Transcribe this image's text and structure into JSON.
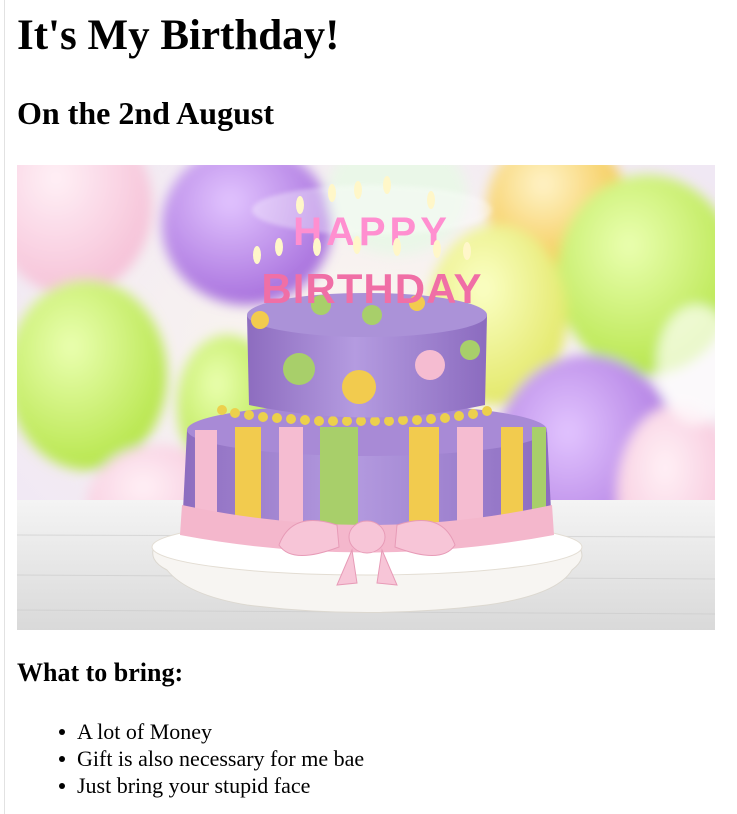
{
  "page": {
    "title": "It's My Birthday!",
    "subtitle": "On the 2nd August",
    "image_alt": "Birthday cake with candles",
    "image_text_top": "HAPPY",
    "image_text_bottom": "BIRTHDAY",
    "bring_heading": "What to bring:",
    "bring_items": [
      "A lot of Money",
      "Gift is also necessary for me bae",
      "Just bring your stupid face"
    ]
  },
  "colors": {
    "cake_purple": "#9b7fc9",
    "ribbon_pink": "#f3b6cc",
    "stripe_green": "#a8cf6a",
    "stripe_yellow": "#f2cb4e",
    "balloon_green": "#c8ef5e",
    "balloon_purple": "#b27ee6",
    "balloon_yellow": "#ecef6a"
  }
}
